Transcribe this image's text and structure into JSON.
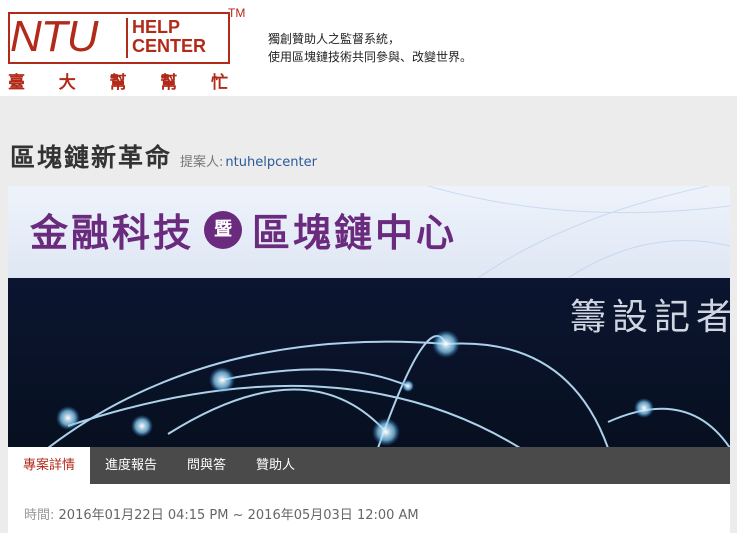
{
  "header": {
    "logo": {
      "ntu": "NTU",
      "help": "HELP",
      "center": "CENTER",
      "tm": "TM",
      "chinese_chars": [
        "臺",
        "大",
        "幫",
        "幫",
        "忙"
      ]
    },
    "slogan_line1": "獨創贊助人之監督系統，",
    "slogan_line2": "使用區塊鏈技術共同參與、改變世界。"
  },
  "project": {
    "title": "區塊鏈新革命",
    "proposer_label": "提案人:",
    "proposer_name": "ntuhelpcenter"
  },
  "banner": {
    "head_left": "金融科技",
    "badge": "暨",
    "head_right": "區塊鏈中心",
    "subtitle": "籌設記者"
  },
  "tabs": [
    {
      "label": "專案詳情",
      "active": true
    },
    {
      "label": "進度報告",
      "active": false
    },
    {
      "label": "問與答",
      "active": false
    },
    {
      "label": "贊助人",
      "active": false
    }
  ],
  "details": {
    "time_label": "時間:",
    "time_value": "2016年01月22日 04:15 PM ~ 2016年05月03日 12:00 AM"
  },
  "colors": {
    "brand_red": "#b22a1a",
    "banner_purple": "#6a2a7d",
    "tabbar_bg": "#4a4a4a",
    "link_blue": "#2a5a9a"
  }
}
